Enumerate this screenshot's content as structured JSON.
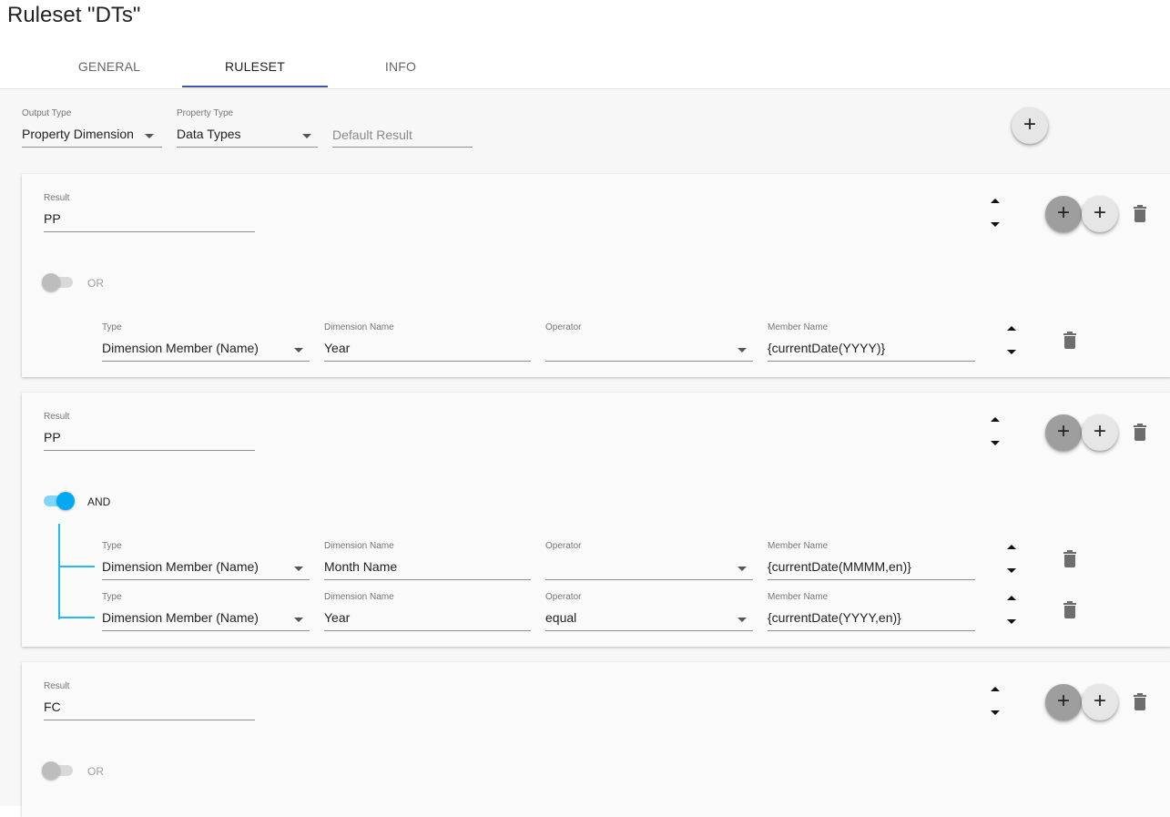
{
  "page": {
    "title": "Ruleset \"DTs\""
  },
  "tabs": [
    {
      "label": "GENERAL",
      "active": false
    },
    {
      "label": "RULESET",
      "active": true
    },
    {
      "label": "INFO",
      "active": false
    }
  ],
  "colors": {
    "tab_indicator": "#3f51b5",
    "toggle_on": "#03a9f4",
    "toggle_on_track": "#81d4fa",
    "tree_line": "#29b6f6"
  },
  "header": {
    "output_type": {
      "label": "Output Type",
      "value": "Property Dimension"
    },
    "property_type": {
      "label": "Property Type",
      "value": "Data Types"
    },
    "default_result": {
      "placeholder": "Default Result",
      "value": ""
    },
    "add_button_icon": "plus-icon"
  },
  "rules": [
    {
      "result_label": "Result",
      "result_value": "PP",
      "toggle": {
        "state": "off",
        "label": "OR"
      },
      "conditions": [
        {
          "type_label": "Type",
          "type_value": "Dimension Member (Name)",
          "dimension_label": "Dimension Name",
          "dimension_value": "Year",
          "operator_label": "Operator",
          "operator_value": "",
          "member_label": "Member Name",
          "member_value": "{currentDate(YYYY)}"
        }
      ]
    },
    {
      "result_label": "Result",
      "result_value": "PP",
      "toggle": {
        "state": "on",
        "label": "AND"
      },
      "conditions": [
        {
          "type_label": "Type",
          "type_value": "Dimension Member (Name)",
          "dimension_label": "Dimension Name",
          "dimension_value": "Month Name",
          "operator_label": "Operator",
          "operator_value": "",
          "member_label": "Member Name",
          "member_value": "{currentDate(MMMM,en)}"
        },
        {
          "type_label": "Type",
          "type_value": "Dimension Member (Name)",
          "dimension_label": "Dimension Name",
          "dimension_value": "Year",
          "operator_label": "Operator",
          "operator_value": "equal",
          "member_label": "Member Name",
          "member_value": "{currentDate(YYYY,en)}"
        }
      ]
    },
    {
      "result_label": "Result",
      "result_value": "FC",
      "toggle": {
        "state": "off",
        "label": "OR"
      },
      "conditions": []
    }
  ]
}
